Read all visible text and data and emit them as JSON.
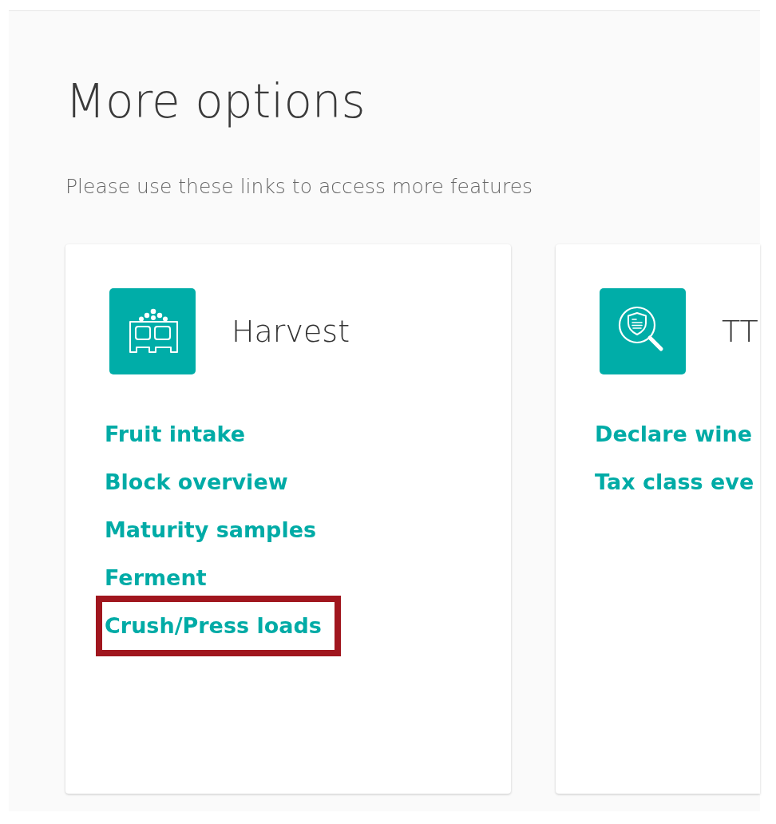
{
  "page": {
    "title": "More options",
    "subtitle": "Please use these links to access more features"
  },
  "cards": [
    {
      "kind": "harvest",
      "title": "Harvest",
      "links": [
        {
          "label": "Fruit intake",
          "highlighted": false
        },
        {
          "label": "Block overview",
          "highlighted": false
        },
        {
          "label": "Maturity samples",
          "highlighted": false
        },
        {
          "label": "Ferment",
          "highlighted": false
        },
        {
          "label": "Crush/Press loads",
          "highlighted": true
        }
      ]
    },
    {
      "kind": "inspection",
      "title": "TT",
      "links": [
        {
          "label": "Declare wine",
          "highlighted": false
        },
        {
          "label": "Tax class eve",
          "highlighted": false
        }
      ]
    }
  ]
}
